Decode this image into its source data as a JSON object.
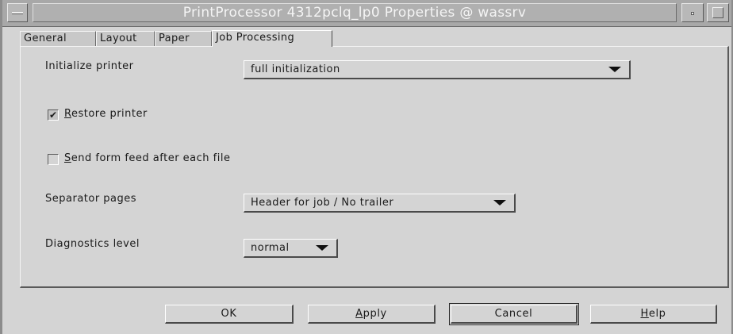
{
  "window": {
    "title": "PrintProcessor 4312pclq_lp0 Properties @ wassrv"
  },
  "tabs": [
    {
      "label": "General",
      "active": false
    },
    {
      "label": "Layout",
      "active": false
    },
    {
      "label": "Paper",
      "active": false
    },
    {
      "label": "Job Processing",
      "active": true
    }
  ],
  "fields": {
    "initialize_printer": {
      "label": "Initialize printer",
      "value": "full initialization"
    },
    "restore_printer": {
      "mnemonic": "R",
      "label_rest": "estore printer",
      "checked": true,
      "check_glyph": "✔"
    },
    "send_form_feed": {
      "mnemonic": "S",
      "label_rest": "end form feed after each file",
      "checked": false
    },
    "separator_pages": {
      "label": "Separator pages",
      "value": "Header for job / No trailer"
    },
    "diagnostics_level": {
      "label": "Diagnostics level",
      "value": "normal"
    }
  },
  "buttons": {
    "ok": {
      "label": "OK"
    },
    "apply": {
      "mnemonic": "A",
      "label_rest": "pply"
    },
    "cancel": {
      "label": "Cancel"
    },
    "help": {
      "mnemonic": "H",
      "label_rest": "elp"
    }
  },
  "icons": [
    "window-menu-icon",
    "minimize-icon",
    "maximize-icon",
    "dropdown-arrow-icon",
    "checkmark-icon"
  ],
  "colors": {
    "background": "#d4d4d4",
    "titlebar": "#a8a8a8",
    "title_text": "#f4f4f4"
  }
}
